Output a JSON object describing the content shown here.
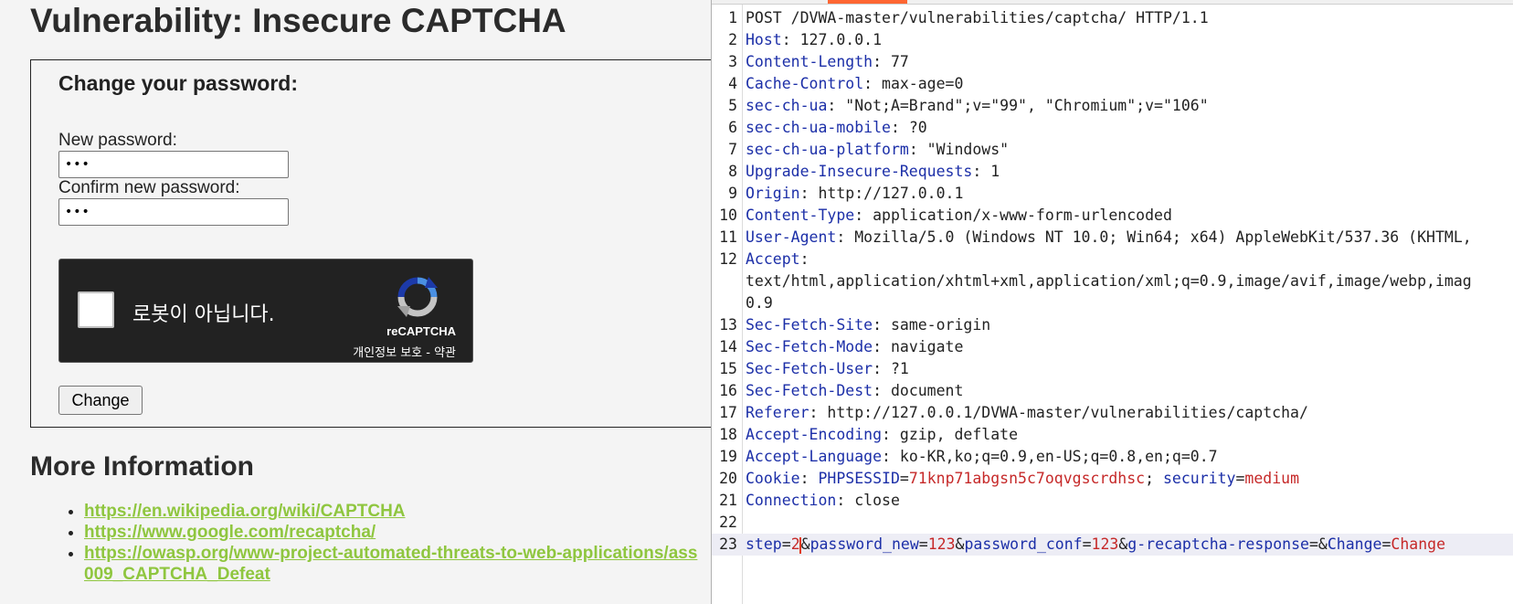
{
  "dvwa": {
    "title": "Vulnerability: Insecure CAPTCHA",
    "form_heading": "Change your password:",
    "new_password_label": "New password:",
    "new_password_value": "•••",
    "confirm_password_label": "Confirm new password:",
    "confirm_password_value": "•••",
    "recaptcha": {
      "checkbox_text": "로봇이 아닙니다.",
      "brand": "reCAPTCHA",
      "terms": "개인정보 보호 - 약관"
    },
    "change_button": "Change",
    "more_info_heading": "More Information",
    "links": [
      "https://en.wikipedia.org/wiki/CAPTCHA",
      "https://www.google.com/recaptcha/",
      "https://owasp.org/www-project-automated-threats-to-web-applications/ass",
      "009_CAPTCHA_Defeat"
    ]
  },
  "request": {
    "lines": [
      {
        "n": "1",
        "segments": [
          {
            "t": "POST /DVWA-master/vulnerabilities/captcha/ HTTP/1.1",
            "c": "p"
          }
        ]
      },
      {
        "n": "2",
        "segments": [
          {
            "t": "Host",
            "c": "k"
          },
          {
            "t": ": 127.0.0.1",
            "c": "p"
          }
        ]
      },
      {
        "n": "3",
        "segments": [
          {
            "t": "Content-Length",
            "c": "k"
          },
          {
            "t": ": 77",
            "c": "p"
          }
        ]
      },
      {
        "n": "4",
        "segments": [
          {
            "t": "Cache-Control",
            "c": "k"
          },
          {
            "t": ": max-age=0",
            "c": "p"
          }
        ]
      },
      {
        "n": "5",
        "segments": [
          {
            "t": "sec-ch-ua",
            "c": "k"
          },
          {
            "t": ": \"Not;A=Brand\";v=\"99\", \"Chromium\";v=\"106\"",
            "c": "p"
          }
        ]
      },
      {
        "n": "6",
        "segments": [
          {
            "t": "sec-ch-ua-mobile",
            "c": "k"
          },
          {
            "t": ": ?0",
            "c": "p"
          }
        ]
      },
      {
        "n": "7",
        "segments": [
          {
            "t": "sec-ch-ua-platform",
            "c": "k"
          },
          {
            "t": ": \"Windows\"",
            "c": "p"
          }
        ]
      },
      {
        "n": "8",
        "segments": [
          {
            "t": "Upgrade-Insecure-Requests",
            "c": "k"
          },
          {
            "t": ": 1",
            "c": "p"
          }
        ]
      },
      {
        "n": "9",
        "segments": [
          {
            "t": "Origin",
            "c": "k"
          },
          {
            "t": ": http://127.0.0.1",
            "c": "p"
          }
        ]
      },
      {
        "n": "10",
        "segments": [
          {
            "t": "Content-Type",
            "c": "k"
          },
          {
            "t": ": application/x-www-form-urlencoded",
            "c": "p"
          }
        ]
      },
      {
        "n": "11",
        "segments": [
          {
            "t": "User-Agent",
            "c": "k"
          },
          {
            "t": ": Mozilla/5.0 (Windows NT 10.0; Win64; x64) AppleWebKit/537.36 (KHTML,",
            "c": "p"
          }
        ]
      },
      {
        "n": "12",
        "segments": [
          {
            "t": "Accept",
            "c": "k"
          },
          {
            "t": ":",
            "c": "p"
          }
        ]
      },
      {
        "n": "",
        "segments": [
          {
            "t": "text/html,application/xhtml+xml,application/xml;q=0.9,image/avif,image/webp,imag",
            "c": "p"
          }
        ]
      },
      {
        "n": "",
        "segments": [
          {
            "t": "0.9",
            "c": "p"
          }
        ]
      },
      {
        "n": "13",
        "segments": [
          {
            "t": "Sec-Fetch-Site",
            "c": "k"
          },
          {
            "t": ": same-origin",
            "c": "p"
          }
        ]
      },
      {
        "n": "14",
        "segments": [
          {
            "t": "Sec-Fetch-Mode",
            "c": "k"
          },
          {
            "t": ": navigate",
            "c": "p"
          }
        ]
      },
      {
        "n": "15",
        "segments": [
          {
            "t": "Sec-Fetch-User",
            "c": "k"
          },
          {
            "t": ": ?1",
            "c": "p"
          }
        ]
      },
      {
        "n": "16",
        "segments": [
          {
            "t": "Sec-Fetch-Dest",
            "c": "k"
          },
          {
            "t": ": document",
            "c": "p"
          }
        ]
      },
      {
        "n": "17",
        "segments": [
          {
            "t": "Referer",
            "c": "k"
          },
          {
            "t": ": http://127.0.0.1/DVWA-master/vulnerabilities/captcha/",
            "c": "p"
          }
        ]
      },
      {
        "n": "18",
        "segments": [
          {
            "t": "Accept-Encoding",
            "c": "k"
          },
          {
            "t": ": gzip, deflate",
            "c": "p"
          }
        ]
      },
      {
        "n": "19",
        "segments": [
          {
            "t": "Accept-Language",
            "c": "k"
          },
          {
            "t": ": ko-KR,ko;q=0.9,en-US;q=0.8,en;q=0.7",
            "c": "p"
          }
        ]
      },
      {
        "n": "20",
        "segments": [
          {
            "t": "Cookie",
            "c": "k"
          },
          {
            "t": ": ",
            "c": "p"
          },
          {
            "t": "PHPSESSID",
            "c": "k"
          },
          {
            "t": "=",
            "c": "p"
          },
          {
            "t": "71knp71abgsn5c7oqvgscrdhsc",
            "c": "v"
          },
          {
            "t": "; ",
            "c": "p"
          },
          {
            "t": "security",
            "c": "k"
          },
          {
            "t": "=",
            "c": "p"
          },
          {
            "t": "medium",
            "c": "v"
          }
        ]
      },
      {
        "n": "21",
        "segments": [
          {
            "t": "Connection",
            "c": "k"
          },
          {
            "t": ": close",
            "c": "p"
          }
        ]
      },
      {
        "n": "22",
        "segments": []
      },
      {
        "n": "23",
        "current": true,
        "segments": [
          {
            "t": "step",
            "c": "k"
          },
          {
            "t": "=",
            "c": "p"
          },
          {
            "t": "2",
            "c": "v"
          },
          {
            "t": "",
            "c": "caret"
          },
          {
            "t": "&",
            "c": "p"
          },
          {
            "t": "password_new",
            "c": "k"
          },
          {
            "t": "=",
            "c": "p"
          },
          {
            "t": "123",
            "c": "v"
          },
          {
            "t": "&",
            "c": "p"
          },
          {
            "t": "password_conf",
            "c": "k"
          },
          {
            "t": "=",
            "c": "p"
          },
          {
            "t": "123",
            "c": "v"
          },
          {
            "t": "&",
            "c": "p"
          },
          {
            "t": "g-recaptcha-response",
            "c": "k"
          },
          {
            "t": "=&",
            "c": "p"
          },
          {
            "t": "Change",
            "c": "k"
          },
          {
            "t": "=",
            "c": "p"
          },
          {
            "t": "Change",
            "c": "v"
          }
        ]
      }
    ]
  },
  "colors": {
    "key": "#1c2fa8",
    "value": "#c62929",
    "link": "#8fc63f",
    "recaptcha_bg": "#222222"
  }
}
